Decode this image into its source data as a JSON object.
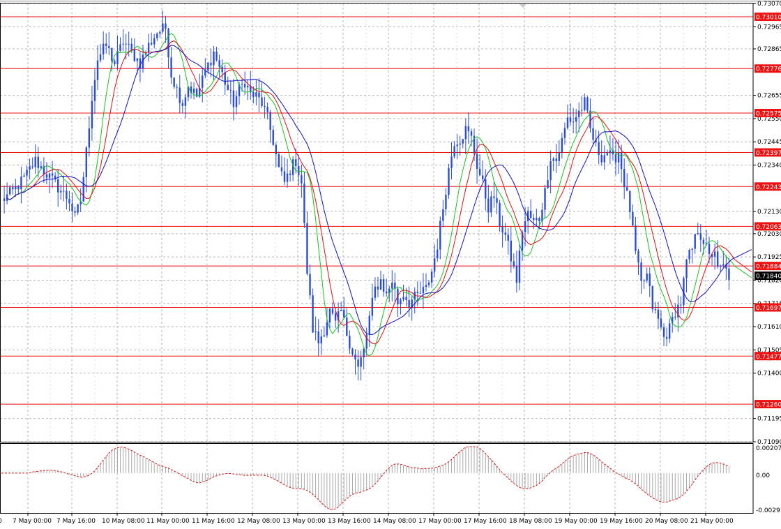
{
  "chart_data": {
    "type": "candlestick",
    "price_axis": {
      "ylim": [
        0.7109,
        0.7307
      ],
      "ticks": [
        "0.73070",
        "0.72965",
        "0.72865",
        "0.72655",
        "0.72550",
        "0.72445",
        "0.72340",
        "0.72130",
        "0.72030",
        "0.71925",
        "0.71820",
        "0.71715",
        "0.71610",
        "0.71505",
        "0.71400",
        "0.71195",
        "0.71090"
      ],
      "ticks_partial": [
        "0.71295"
      ]
    },
    "levels": [
      {
        "value": 0.7301,
        "label": "0.73010"
      },
      {
        "value": 0.72776,
        "label": "0.72776"
      },
      {
        "value": 0.72575,
        "label": "0.72575"
      },
      {
        "value": 0.72397,
        "label": "0.72397"
      },
      {
        "value": 0.72243,
        "label": "0.72243"
      },
      {
        "value": 0.72063,
        "label": "0.72063"
      },
      {
        "value": 0.71884,
        "label": "0.71884"
      },
      {
        "value": 0.71697,
        "label": "0.71697"
      },
      {
        "value": 0.71477,
        "label": "0.71477"
      },
      {
        "value": 0.7126,
        "label": "0.71260"
      }
    ],
    "current_price": {
      "value": 0.7184,
      "label": "0.71840"
    },
    "time_axis": [
      "7 May 00:00",
      "7 May 16:00",
      "10 May 08:00",
      "11 May 00:00",
      "11 May 16:00",
      "12 May 08:00",
      "13 May 00:00",
      "13 May 16:00",
      "14 May 08:00",
      "17 May 00:00",
      "17 May 16:00",
      "18 May 08:00",
      "19 May 00:00",
      "19 May 16:00",
      "20 May 08:00",
      "21 May 00:00"
    ],
    "close_path": [
      [
        0,
        0.7218
      ],
      [
        4,
        0.7222
      ],
      [
        8,
        0.7228
      ],
      [
        12,
        0.7236
      ],
      [
        16,
        0.723
      ],
      [
        20,
        0.7224
      ],
      [
        24,
        0.7218
      ],
      [
        26,
        0.721
      ],
      [
        28,
        0.7218
      ],
      [
        30,
        0.724
      ],
      [
        32,
        0.7265
      ],
      [
        34,
        0.7282
      ],
      [
        37,
        0.7288
      ],
      [
        40,
        0.728
      ],
      [
        43,
        0.729
      ],
      [
        46,
        0.7285
      ],
      [
        49,
        0.728
      ],
      [
        52,
        0.7288
      ],
      [
        55,
        0.7294
      ],
      [
        58,
        0.7296
      ],
      [
        60,
        0.7275
      ],
      [
        62,
        0.7268
      ],
      [
        64,
        0.7262
      ],
      [
        66,
        0.727
      ],
      [
        69,
        0.7265
      ],
      [
        72,
        0.7276
      ],
      [
        75,
        0.7285
      ],
      [
        78,
        0.7275
      ],
      [
        80,
        0.7268
      ],
      [
        82,
        0.7262
      ],
      [
        84,
        0.7268
      ],
      [
        86,
        0.7272
      ],
      [
        88,
        0.7266
      ],
      [
        90,
        0.7265
      ],
      [
        92,
        0.7262
      ],
      [
        94,
        0.7255
      ],
      [
        96,
        0.7245
      ],
      [
        98,
        0.7232
      ],
      [
        100,
        0.7226
      ],
      [
        102,
        0.7232
      ],
      [
        104,
        0.7236
      ],
      [
        106,
        0.7226
      ],
      [
        108,
        0.7186
      ],
      [
        110,
        0.716
      ],
      [
        112,
        0.7154
      ],
      [
        114,
        0.716
      ],
      [
        116,
        0.7168
      ],
      [
        118,
        0.7162
      ],
      [
        120,
        0.7168
      ],
      [
        122,
        0.7158
      ],
      [
        124,
        0.715
      ],
      [
        126,
        0.7142
      ],
      [
        128,
        0.715
      ],
      [
        130,
        0.7165
      ],
      [
        132,
        0.7178
      ],
      [
        134,
        0.7182
      ],
      [
        136,
        0.7175
      ],
      [
        138,
        0.7182
      ],
      [
        140,
        0.7172
      ],
      [
        142,
        0.7176
      ],
      [
        144,
        0.7172
      ],
      [
        146,
        0.7174
      ],
      [
        148,
        0.7176
      ],
      [
        150,
        0.7178
      ],
      [
        152,
        0.7186
      ],
      [
        154,
        0.7198
      ],
      [
        156,
        0.7215
      ],
      [
        158,
        0.7232
      ],
      [
        160,
        0.7245
      ],
      [
        162,
        0.7246
      ],
      [
        164,
        0.725
      ],
      [
        166,
        0.7246
      ],
      [
        168,
        0.7234
      ],
      [
        170,
        0.7225
      ],
      [
        172,
        0.7215
      ],
      [
        174,
        0.722
      ],
      [
        176,
        0.7208
      ],
      [
        178,
        0.7202
      ],
      [
        180,
        0.7192
      ],
      [
        182,
        0.7182
      ],
      [
        184,
        0.7205
      ],
      [
        186,
        0.7212
      ],
      [
        188,
        0.7208
      ],
      [
        190,
        0.721
      ],
      [
        192,
        0.7222
      ],
      [
        194,
        0.7238
      ],
      [
        196,
        0.7236
      ],
      [
        198,
        0.7245
      ],
      [
        200,
        0.7255
      ],
      [
        202,
        0.7254
      ],
      [
        204,
        0.7258
      ],
      [
        206,
        0.7262
      ],
      [
        208,
        0.725
      ],
      [
        210,
        0.7242
      ],
      [
        212,
        0.7238
      ],
      [
        214,
        0.724
      ],
      [
        216,
        0.7236
      ],
      [
        218,
        0.724
      ],
      [
        220,
        0.7226
      ],
      [
        222,
        0.7214
      ],
      [
        224,
        0.7194
      ],
      [
        226,
        0.718
      ],
      [
        228,
        0.7184
      ],
      [
        230,
        0.717
      ],
      [
        232,
        0.7164
      ],
      [
        234,
        0.7156
      ],
      [
        236,
        0.716
      ],
      [
        238,
        0.7168
      ],
      [
        240,
        0.7172
      ],
      [
        242,
        0.719
      ],
      [
        244,
        0.7196
      ],
      [
        246,
        0.7205
      ],
      [
        248,
        0.72
      ],
      [
        250,
        0.7192
      ],
      [
        252,
        0.7196
      ],
      [
        253,
        0.7186
      ],
      [
        255,
        0.7188
      ],
      [
        257,
        0.7184
      ]
    ],
    "bars": 258,
    "oscillator": {
      "ticks": [
        "0.002074",
        "0.00",
        "-0.00291"
      ],
      "range": [
        -0.00291,
        0.002074
      ]
    },
    "colors": {
      "candles": "#2a4dd9",
      "ma_fast": "#18c418",
      "ma_mid": "#e01010",
      "ma_slow": "#1010c8",
      "level": "#ee1111",
      "grid": "#b4b4b4",
      "osc_line": "#d81818",
      "osc_hist": "#a8a8a8",
      "current_badge": "#000000"
    }
  }
}
